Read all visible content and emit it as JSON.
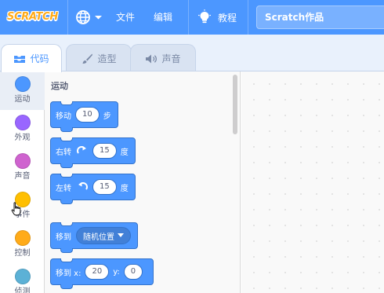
{
  "menubar": {
    "logo_text": "SCRATCH",
    "file_label": "文件",
    "edit_label": "编辑",
    "tutorials_label": "教程",
    "project_title": "Scratch作品"
  },
  "tabs": [
    {
      "label": "代码",
      "icon": "code-icon",
      "active": true
    },
    {
      "label": "造型",
      "icon": "brush-icon",
      "active": false
    },
    {
      "label": "声音",
      "icon": "speaker-icon",
      "active": false
    }
  ],
  "categories": [
    {
      "label": "运动",
      "color": "#4c97ff",
      "selected": true
    },
    {
      "label": "外观",
      "color": "#9966ff",
      "selected": false
    },
    {
      "label": "声音",
      "color": "#cf63cf",
      "selected": false
    },
    {
      "label": "事件",
      "color": "#ffbf00",
      "selected": false
    },
    {
      "label": "控制",
      "color": "#ffab19",
      "selected": false
    },
    {
      "label": "侦测",
      "color": "#5cb1d6",
      "selected": false
    }
  ],
  "palette": {
    "section_title": "运动",
    "blocks": {
      "move": {
        "prefix": "移动",
        "value": "10",
        "suffix": "步"
      },
      "turn_right": {
        "prefix": "右转",
        "icon": "rotate-clockwise-icon",
        "value": "15",
        "suffix": "度"
      },
      "turn_left": {
        "prefix": "左转",
        "icon": "rotate-counterclockwise-icon",
        "value": "15",
        "suffix": "度"
      },
      "goto": {
        "prefix": "移到",
        "dropdown": "随机位置"
      },
      "goto_xy": {
        "prefix": "移到 x:",
        "x_value": "20",
        "y_label": "y:",
        "y_value": "0"
      }
    }
  },
  "colors": {
    "menubar": "#4c97ff",
    "motion_block": "#4c97ff",
    "logo": "#ffab19"
  }
}
